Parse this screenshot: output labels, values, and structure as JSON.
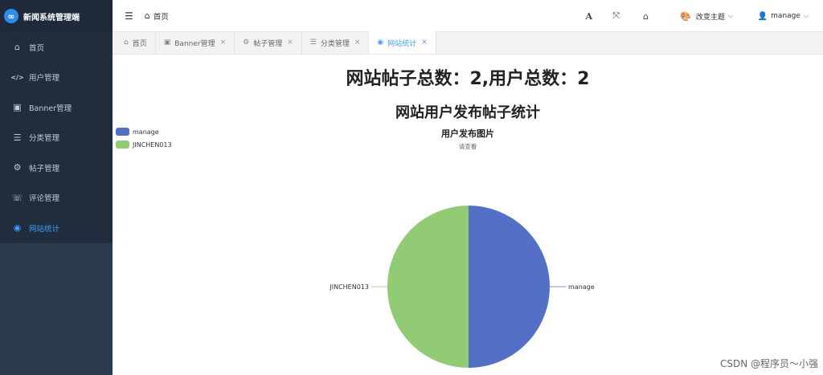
{
  "app": {
    "brand_title": "新闻系统管理端",
    "brand_logo": "∞"
  },
  "sidebar": {
    "items": [
      {
        "label": "首页",
        "icon": "home-icon",
        "glyph": "⌂",
        "active": false
      },
      {
        "label": "用户管理",
        "icon": "code-icon",
        "glyph": "</>",
        "active": false
      },
      {
        "label": "Banner管理",
        "icon": "image-icon",
        "glyph": "▣",
        "active": false
      },
      {
        "label": "分类管理",
        "icon": "list-icon",
        "glyph": "☰",
        "active": false
      },
      {
        "label": "帖子管理",
        "icon": "gear-icon",
        "glyph": "⚙",
        "active": false
      },
      {
        "label": "评论管理",
        "icon": "comments-icon",
        "glyph": "☏",
        "active": false
      },
      {
        "label": "网站统计",
        "icon": "globe-icon",
        "glyph": "◉",
        "active": true
      }
    ]
  },
  "header": {
    "breadcrumb_home": "首页",
    "theme_label": "改变主题",
    "user_label": "manage",
    "font_button": "A",
    "fullscreen_glyph": "⤧",
    "home_glyph": "⌂"
  },
  "tabs": [
    {
      "label": "首页",
      "icon": "home-icon",
      "glyph": "⌂",
      "closable": false,
      "active": false
    },
    {
      "label": "Banner管理",
      "icon": "image-icon",
      "glyph": "▣",
      "closable": true,
      "active": false
    },
    {
      "label": "帖子管理",
      "icon": "gear-icon",
      "glyph": "⚙",
      "closable": true,
      "active": false
    },
    {
      "label": "分类管理",
      "icon": "list-icon",
      "glyph": "☰",
      "closable": true,
      "active": false
    },
    {
      "label": "网站统计",
      "icon": "globe-icon",
      "glyph": "◉",
      "closable": true,
      "active": true
    }
  ],
  "content": {
    "summary": "网站帖子总数：2,用户总数：2",
    "stats_title": "网站用户发布帖子统计"
  },
  "chart_data": {
    "type": "pie",
    "title": "用户发布图片",
    "subtitle": "请查看",
    "legend_position": "top-left",
    "categories": [
      "manage",
      "JINCHEN013"
    ],
    "values": [
      1,
      1
    ],
    "colors": [
      "#5470c6",
      "#91cc75"
    ]
  },
  "watermark": "CSDN @程序员～小强"
}
